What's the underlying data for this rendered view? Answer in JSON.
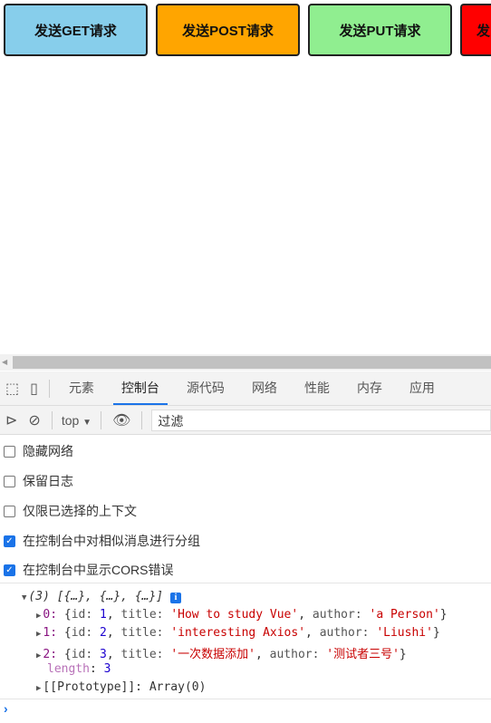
{
  "buttons": [
    {
      "label": "发送GET请求",
      "color": "#87ceeb"
    },
    {
      "label": "发送POST请求",
      "color": "#ffa500"
    },
    {
      "label": "发送PUT请求",
      "color": "#90ee90"
    },
    {
      "label": "发",
      "color": "#ff0000"
    }
  ],
  "devtools": {
    "tabs": [
      "元素",
      "控制台",
      "源代码",
      "网络",
      "性能",
      "内存",
      "应用"
    ],
    "active_tab": "控制台",
    "context": "top",
    "filter_placeholder": "过滤",
    "settings": [
      {
        "label": "隐藏网络",
        "checked": false
      },
      {
        "label": "保留日志",
        "checked": false
      },
      {
        "label": "仅限已选择的上下文",
        "checked": false
      },
      {
        "label": "在控制台中对相似消息进行分组",
        "checked": true
      },
      {
        "label": "在控制台中显示CORS错误",
        "checked": true
      }
    ],
    "output": {
      "summary": "(3) [{…}, {…}, {…}]",
      "items": [
        {
          "index": "0",
          "id": "1",
          "title": "'How to study Vue'",
          "author": "'a Person'"
        },
        {
          "index": "1",
          "id": "2",
          "title": "'interesting Axios'",
          "author": "'Liushi'"
        },
        {
          "index": "2",
          "id": "3",
          "title": "'一次数据添加'",
          "author": "'测试者三号'"
        }
      ],
      "length_key": "length",
      "length": "3",
      "prototype": "[[Prototype]]: Array(0)"
    },
    "prompt": "›"
  }
}
